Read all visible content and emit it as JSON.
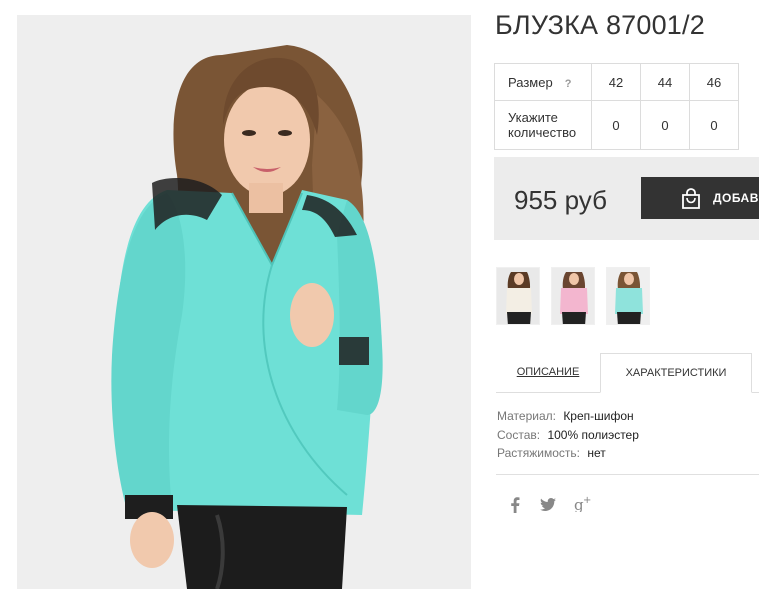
{
  "product": {
    "title": "БЛУЗКА 87001/2",
    "price": "955 руб",
    "add_button_label": "ДОБАВИТЬ",
    "icons": {
      "add": "shopping-bag-icon"
    }
  },
  "size_table": {
    "size_label": "Размер",
    "help": "?",
    "sizes": [
      "42",
      "44",
      "46"
    ],
    "qty_label": "Укажите количество",
    "quantities": [
      "0",
      "0",
      "0"
    ]
  },
  "thumbnails": [
    {
      "name": "thumbnail-white-blouse",
      "color": "#f2ede4"
    },
    {
      "name": "thumbnail-pink-blouse",
      "color": "#f3b6cf"
    },
    {
      "name": "thumbnail-mint-blouse",
      "color": "#8fe3dc"
    }
  ],
  "tabs": [
    {
      "label": "ОПИСАНИЕ",
      "active": false
    },
    {
      "label": "ХАРАКТЕРИСТИКИ",
      "active": true
    }
  ],
  "characteristics": [
    {
      "key": "Материал:",
      "value": "Креп-шифон"
    },
    {
      "key": "Состав:",
      "value": "100% полиэстер"
    },
    {
      "key": "Растяжимость:",
      "value": "нет"
    }
  ],
  "social": [
    {
      "name": "facebook-icon",
      "glyph": "f"
    },
    {
      "name": "twitter-icon",
      "glyph": "🐦"
    },
    {
      "name": "google-plus-icon",
      "glyph": "g⁺"
    }
  ],
  "colors": {
    "blouse": "#6ee0d6",
    "button": "#333333",
    "price_bg": "#ececec"
  }
}
